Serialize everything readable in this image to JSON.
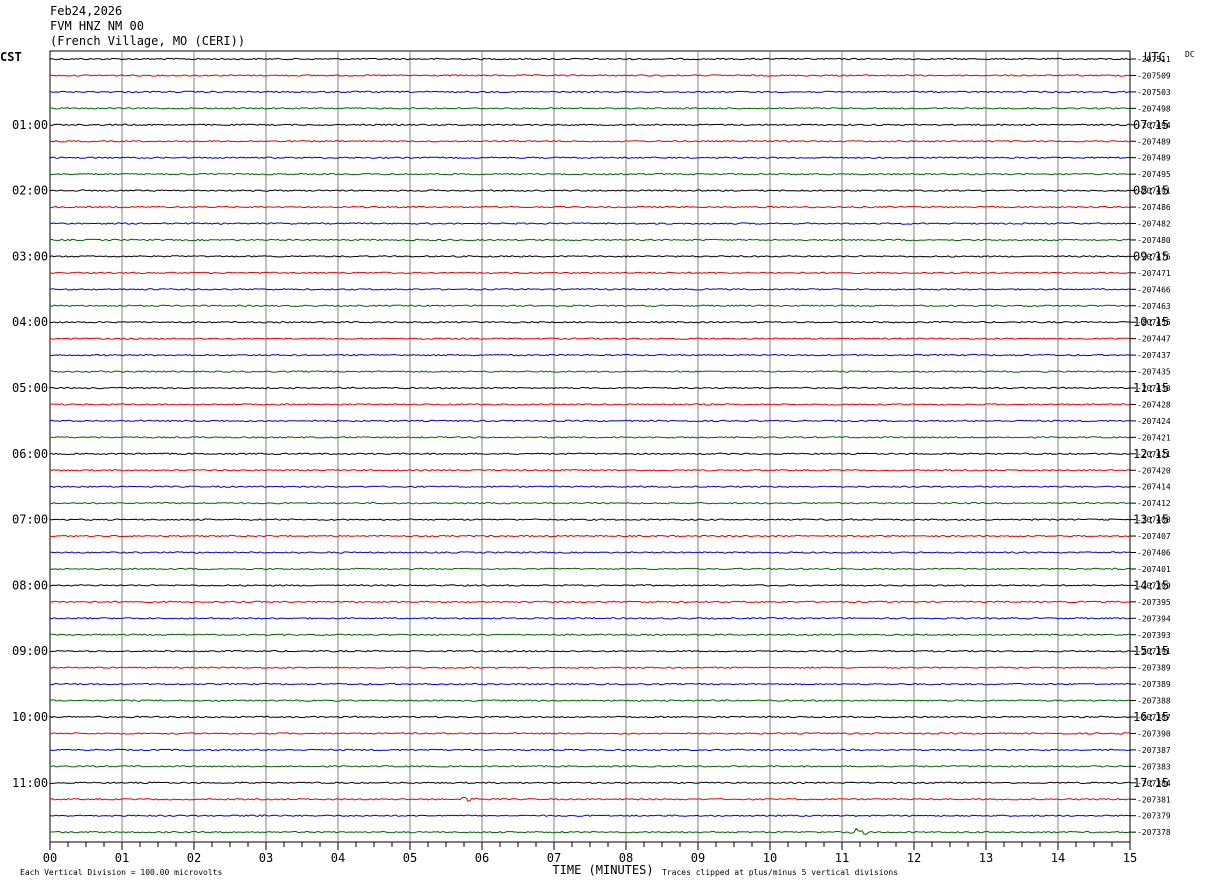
{
  "header": {
    "date": "Feb24,2026",
    "station": "FVM HNZ NM 00",
    "location": "(French Village, MO (CERI))"
  },
  "chart_data": {
    "type": "line",
    "left_timezone": "CST",
    "right_timezone": "UTC",
    "right_header": "DC",
    "colors": [
      "#000000",
      "#e00000",
      "#0000c8",
      "#006400"
    ],
    "left_hour_labels": [
      "01:00",
      "02:00",
      "03:00",
      "04:00",
      "05:00",
      "06:00",
      "07:00",
      "08:00",
      "09:00",
      "10:00",
      "11:00"
    ],
    "right_hour_labels": [
      "07:15",
      "08:15",
      "09:15",
      "10:15",
      "11:15",
      "12:15",
      "13:15",
      "14:15",
      "15:15",
      "16:15",
      "17:15"
    ],
    "dc_offsets": [
      "-207511",
      "-207509",
      "-207503",
      "-207498",
      "-207494",
      "-207489",
      "-207489",
      "-207495",
      "-207491",
      "-207486",
      "-207482",
      "-207480",
      "-207476",
      "-207471",
      "-207466",
      "-207463",
      "-207455",
      "-207447",
      "-207437",
      "-207435",
      "-207430",
      "-207428",
      "-207424",
      "-207421",
      "-207421",
      "-207420",
      "-207414",
      "-207412",
      "-207408",
      "-207407",
      "-207406",
      "-207401",
      "-207399",
      "-207395",
      "-207394",
      "-207393",
      "-207391",
      "-207389",
      "-207389",
      "-207388",
      "-207387",
      "-207390",
      "-207387",
      "-207383",
      "-207384",
      "-207381",
      "-207379",
      "-207378"
    ],
    "x_ticks": [
      "00",
      "01",
      "02",
      "03",
      "04",
      "05",
      "06",
      "07",
      "08",
      "09",
      "10",
      "11",
      "12",
      "13",
      "14",
      "15"
    ],
    "xlabel": "TIME (MINUTES)",
    "scale_note": "Each Vertical Division = 100.00 microvolts",
    "clip_note": "Traces clipped at plus/minus 5 vertical divisions",
    "events": [
      {
        "trace": 45,
        "minute": 5.8,
        "amp": 2.5
      },
      {
        "trace": 46,
        "minute": 2.9,
        "amp": 1.6
      },
      {
        "trace": 47,
        "minute": 11.2,
        "amp": 3.5
      }
    ]
  }
}
